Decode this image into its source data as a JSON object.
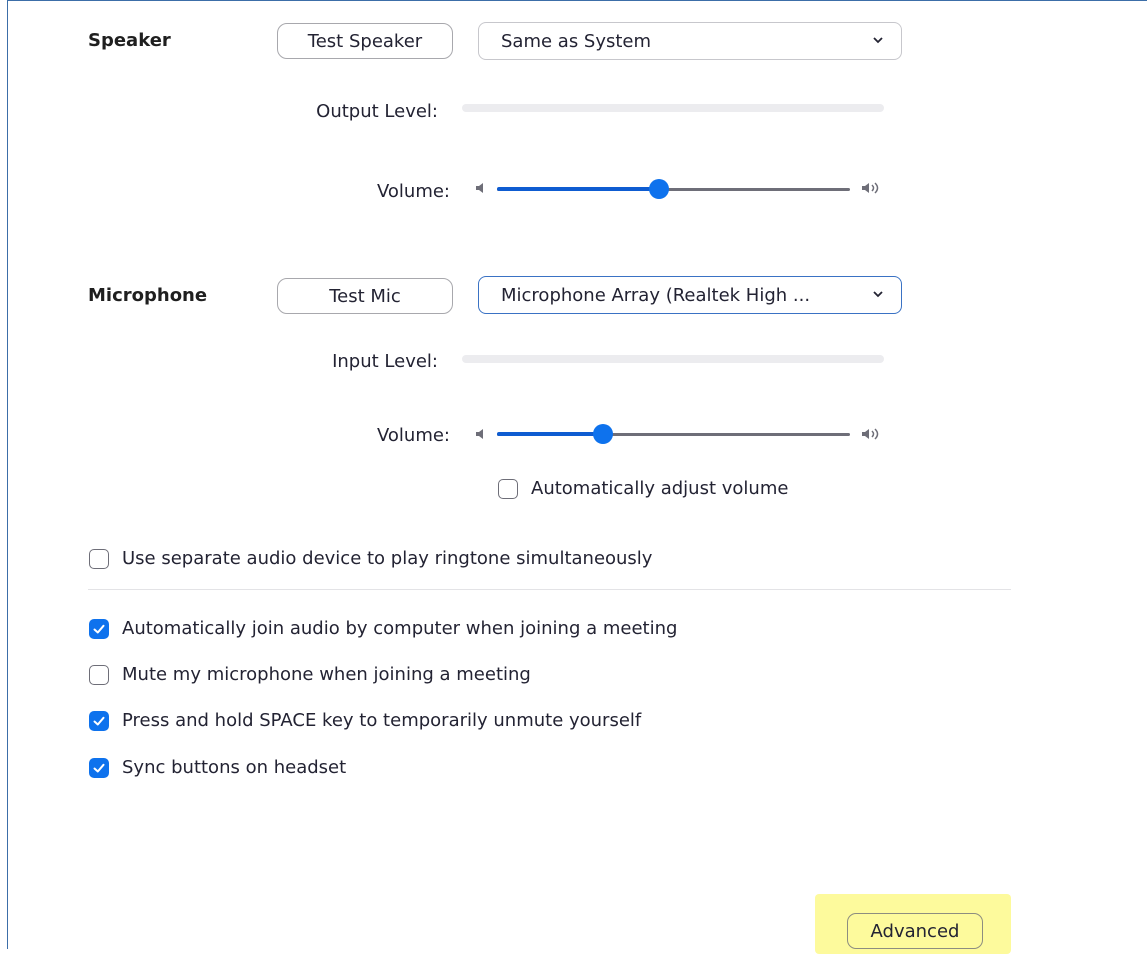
{
  "speaker": {
    "label": "Speaker",
    "test_button": "Test Speaker",
    "device": "Same as System",
    "output_level_label": "Output Level:",
    "output_level": 0,
    "volume_label": "Volume:",
    "volume": 0.46
  },
  "microphone": {
    "label": "Microphone",
    "test_button": "Test Mic",
    "device": "Microphone Array (Realtek High ...",
    "input_level_label": "Input Level:",
    "input_level": 0,
    "volume_label": "Volume:",
    "volume": 0.3,
    "auto_adjust_label": "Automatically adjust volume",
    "auto_adjust_checked": false
  },
  "options": {
    "separate_ringtone": {
      "label": "Use separate audio device to play ringtone simultaneously",
      "checked": false
    },
    "auto_join_audio": {
      "label": "Automatically join audio by computer when joining a meeting",
      "checked": true
    },
    "mute_on_join": {
      "label": "Mute my microphone when joining a meeting",
      "checked": false
    },
    "space_unmute": {
      "label": "Press and hold SPACE key to temporarily unmute yourself",
      "checked": true
    },
    "sync_headset": {
      "label": "Sync buttons on headset",
      "checked": true
    }
  },
  "advanced_button": "Advanced",
  "colors": {
    "accent": "#0e72ed",
    "highlight": "#fdfa9c",
    "frame": "#3c6ea8"
  },
  "icons": {
    "volume_low": "speaker-low-icon",
    "volume_high": "speaker-high-icon",
    "dropdown": "chevron-down-icon",
    "check": "check-icon"
  }
}
